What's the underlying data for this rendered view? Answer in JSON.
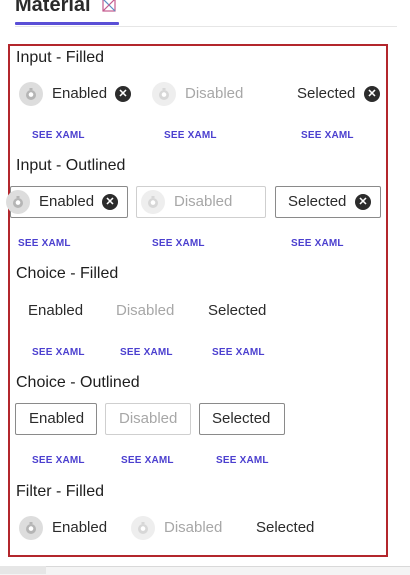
{
  "header": {
    "title": "Material",
    "open_icon": "open-in-new-window-icon"
  },
  "see_xaml_label": "SEE XAML",
  "sections": {
    "input_filled": {
      "title": "Input - Filled",
      "chips": {
        "enabled": "Enabled",
        "disabled": "Disabled",
        "selected": "Selected"
      }
    },
    "input_outlined": {
      "title": "Input - Outlined",
      "chips": {
        "enabled": "Enabled",
        "disabled": "Disabled",
        "selected": "Selected"
      }
    },
    "choice_filled": {
      "title": "Choice - Filled",
      "chips": {
        "enabled": "Enabled",
        "disabled": "Disabled",
        "selected": "Selected"
      }
    },
    "choice_outlined": {
      "title": "Choice - Outlined",
      "chips": {
        "enabled": "Enabled",
        "disabled": "Disabled",
        "selected": "Selected"
      }
    },
    "filter_filled": {
      "title": "Filter - Filled",
      "chips": {
        "enabled": "Enabled",
        "disabled": "Disabled",
        "selected": "Selected"
      }
    }
  },
  "colors": {
    "accent": "#5a4fd6",
    "link": "#4b3fcf",
    "frame": "#b3262c"
  }
}
